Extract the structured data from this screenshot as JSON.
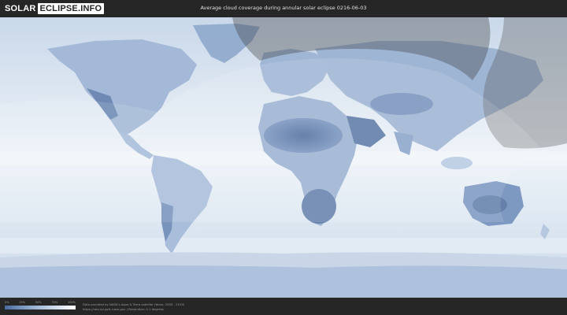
{
  "logo": {
    "solar": "SOLAR",
    "eclipse": "ECLIPSE.INFO"
  },
  "header": {
    "title": "Average cloud coverage during annular solar eclipse 0216-06-03"
  },
  "legend": {
    "ticks": [
      "0%",
      "25%",
      "50%",
      "75%",
      "100%"
    ],
    "gradient_colors": [
      "#4a6a9c",
      "#8aa6cc",
      "#c8d6e8",
      "#ffffff"
    ]
  },
  "credit": {
    "line1": "Data provided by NASA's Aqua & Terra satellite (Years: 2000 - 2019)",
    "line2": "https://neo.sci.gsfc.nasa.gov  |  Resolution: 0.1 degrees"
  },
  "colors": {
    "background": "#262626",
    "ocean": "#dbe6f1",
    "land_dark": "#5f7ca8",
    "shadow_overlay": "#ffffff"
  }
}
